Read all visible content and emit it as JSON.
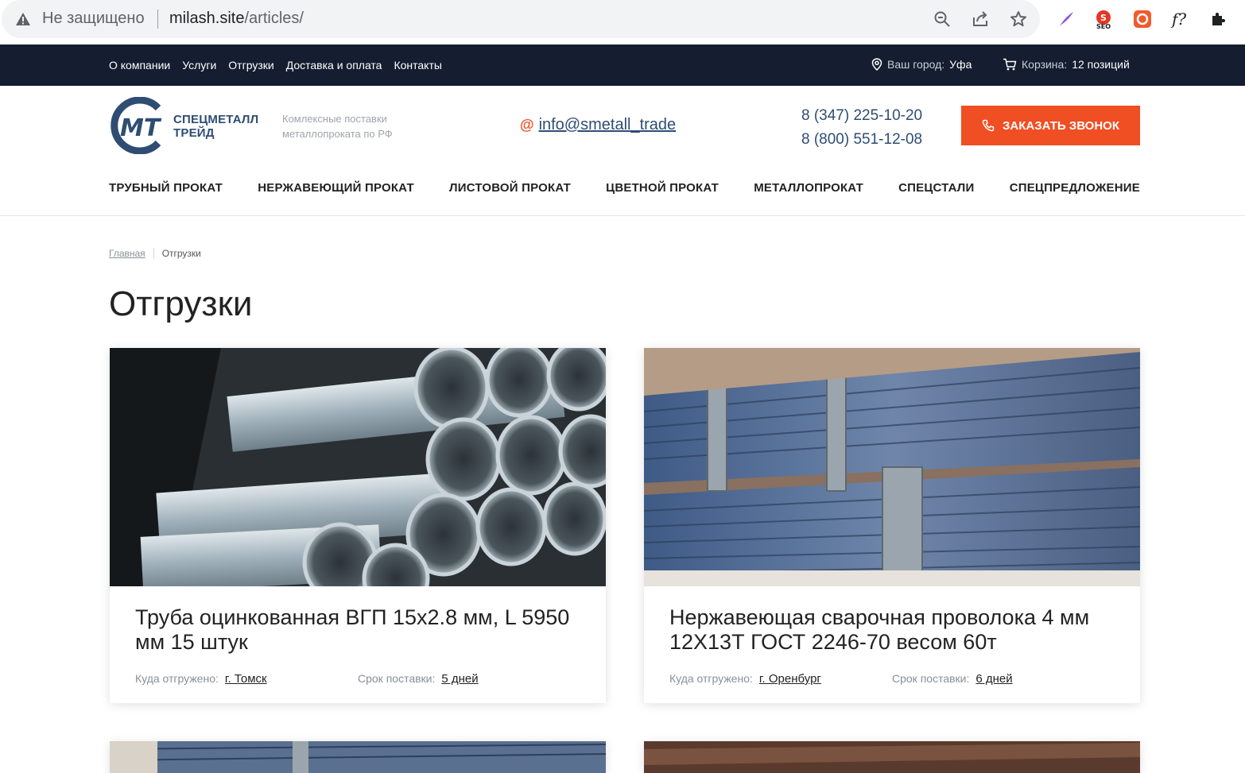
{
  "browser": {
    "security_label": "Не защищено",
    "url_host": "milash.site",
    "url_path": "/articles/"
  },
  "topbar": {
    "nav": [
      "О компании",
      "Услуги",
      "Отгрузки",
      "Доставка и оплата",
      "Контакты"
    ],
    "city_label": "Ваш город:",
    "city_value": "Уфа",
    "cart_label": "Корзина:",
    "cart_value": "12 позиций"
  },
  "header": {
    "logo_line1": "СПЕЦМЕТАЛЛ",
    "logo_line2": "ТРЕЙД",
    "tagline_line1": "Комлексные поставки",
    "tagline_line2": "металлопроката по РФ",
    "email": "info@smetall_trade",
    "phone1": "8 (347) 225-10-20",
    "phone2": "8 (800) 551-12-08",
    "call_button": "ЗАКАЗАТЬ ЗВОНОК"
  },
  "catnav": [
    "ТРУБНЫЙ ПРОКАТ",
    "НЕРЖАВЕЮЩИЙ ПРОКАТ",
    "ЛИСТОВОЙ ПРОКАТ",
    "ЦВЕТНОЙ ПРОКАТ",
    "МЕТАЛЛОПРОКАТ",
    "СПЕЦСТАЛИ",
    "СПЕЦПРЕДЛОЖЕНИЕ"
  ],
  "breadcrumb": {
    "home": "Главная",
    "current": "Отгрузки"
  },
  "page_title": "Отгрузки",
  "cards": [
    {
      "title": "Труба оцинкованная ВГП 15x2.8 мм, L 5950 мм 15 штук",
      "dest_label": "Куда отгружено:",
      "dest_value": "г. Томск",
      "term_label": "Срок поставки:",
      "term_value": "5 дней"
    },
    {
      "title": "Нержавеющая сварочная проволока 4 мм 12Х13Т ГОСТ 2246-70 весом 60т",
      "dest_label": "Куда отгружено:",
      "dest_value": "г. Оренбург",
      "term_label": "Срок поставки:",
      "term_value": "6 дней"
    }
  ],
  "colors": {
    "accent": "#f04e23",
    "navy": "#141e30",
    "brand_blue": "#2f4d73"
  }
}
